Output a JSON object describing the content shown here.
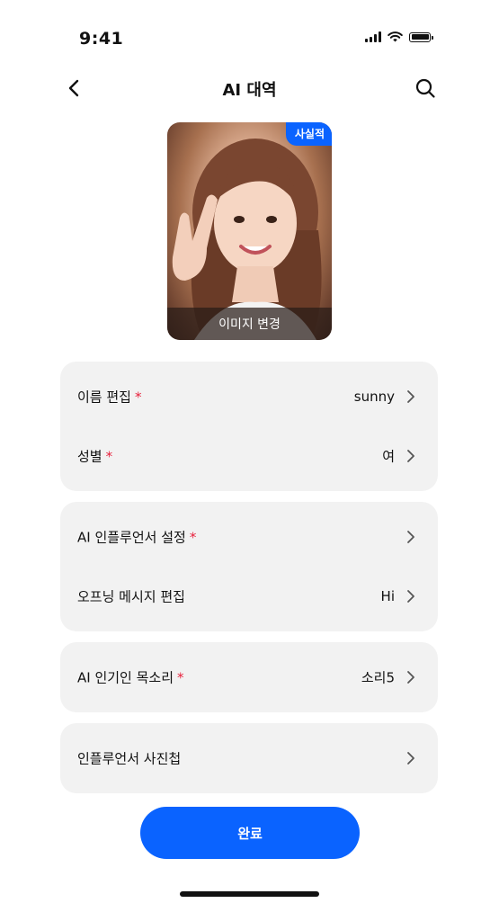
{
  "status_bar": {
    "time": "9:41"
  },
  "header": {
    "title": "AI 대역"
  },
  "avatar": {
    "badge": "사실적",
    "caption": "이미지 변경"
  },
  "groups": [
    {
      "rows": [
        {
          "label": "이름 편집",
          "required": "*",
          "value": "sunny"
        },
        {
          "label": "성별",
          "required": "*",
          "value": "여"
        }
      ]
    },
    {
      "rows": [
        {
          "label": "AI 인플루언서 설정",
          "required": "*",
          "value": ""
        },
        {
          "label": "오프닝 메시지 편집",
          "required": "",
          "value": "Hi"
        }
      ]
    },
    {
      "rows": [
        {
          "label": "AI 인기인 목소리",
          "required": "*",
          "value": "소리5"
        }
      ]
    },
    {
      "rows": [
        {
          "label": "인플루언서 사진첩",
          "required": "",
          "value": ""
        }
      ]
    }
  ],
  "done_button": {
    "label": "완료"
  },
  "colors": {
    "accent": "#0a63ff",
    "required": "#e8243f",
    "group_bg": "#f2f2f2"
  },
  "icons": [
    "back-chevron-icon",
    "search-icon",
    "chevron-right-icon",
    "signal-icon",
    "wifi-icon",
    "battery-icon"
  ]
}
